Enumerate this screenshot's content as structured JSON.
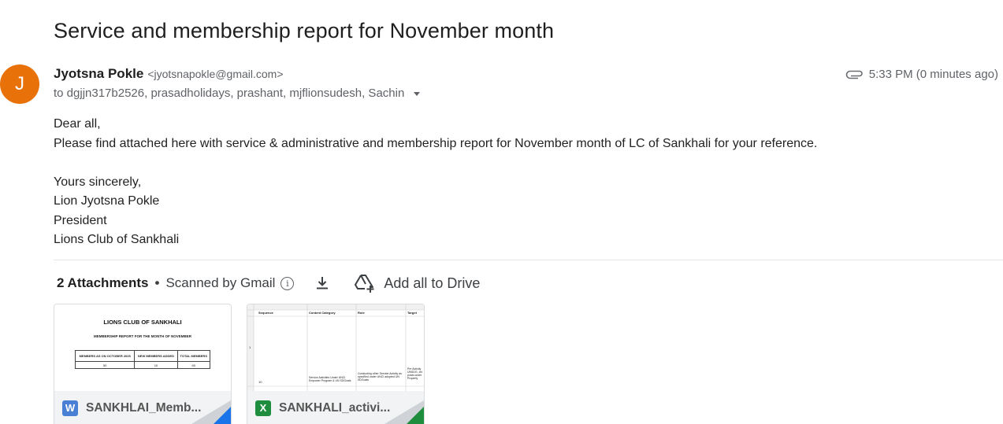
{
  "email": {
    "subject": "Service and membership report for November month",
    "avatar_letter": "J",
    "avatar_color": "#e8710a",
    "sender_name": "Jyotsna Pokle",
    "sender_email": "<jyotsnapokle@gmail.com>",
    "recipients": "to dgjjn317b2526, prasadholidays, prashant, mjflionsudesh, Sachin",
    "time": "5:33 PM (0 minutes ago)",
    "body": {
      "greeting": "Dear all,",
      "message": "Please find attached here with service & administrative and membership report for November month of LC of Sankhali for your reference.",
      "closing": "Yours sincerely,",
      "sig_name": "Lion Jyotsna Pokle",
      "sig_title": "President",
      "sig_org": "Lions Club of Sankhali"
    }
  },
  "attachments": {
    "count_label": "2 Attachments",
    "scanned_label": "Scanned by Gmail",
    "add_all_label": "Add all to Drive",
    "files": [
      {
        "name": "SANKHLAI_Memb...",
        "type_letter": "W",
        "type_color": "#4a7fd6",
        "preview": {
          "title": "LIONS CLUB OF SANKHALI",
          "subtitle": "MEMBERSHIP REPORT FOR THE MONTH OF NOVEMBER",
          "col1": "MEMBERS AS ON OCTOBER 2025",
          "col2": "NEW MEMBERS ADDED",
          "col3": "TOTAL MEMBERS",
          "val1": "50",
          "val2": "10",
          "val3": "60"
        }
      },
      {
        "name": "SANKHALI_activi...",
        "type_letter": "X",
        "type_color": "#1e8e3e",
        "preview": {
          "h1": "Sequence",
          "h2": "Content Category",
          "h3": "Role",
          "h4": "Target",
          "row_num": "1",
          "cell_a": "10",
          "cell_b": "Service Activities Under UNCI Empower Program & UN SDGoals",
          "cell_c": "Conducting other Service Activity as specified under UNCI adopted UN SDGoals",
          "cell_d": "Pre Activity UNSDG, chi posts under Property"
        }
      }
    ]
  }
}
